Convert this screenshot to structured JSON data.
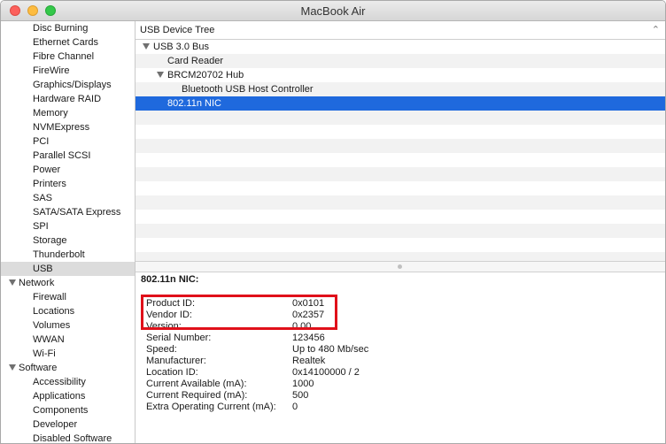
{
  "window": {
    "title": "MacBook Air"
  },
  "sidebar": {
    "items": [
      {
        "label": "Disc Burning",
        "level": 2
      },
      {
        "label": "Ethernet Cards",
        "level": 2
      },
      {
        "label": "Fibre Channel",
        "level": 2
      },
      {
        "label": "FireWire",
        "level": 2
      },
      {
        "label": "Graphics/Displays",
        "level": 2
      },
      {
        "label": "Hardware RAID",
        "level": 2
      },
      {
        "label": "Memory",
        "level": 2
      },
      {
        "label": "NVMExpress",
        "level": 2
      },
      {
        "label": "PCI",
        "level": 2
      },
      {
        "label": "Parallel SCSI",
        "level": 2
      },
      {
        "label": "Power",
        "level": 2
      },
      {
        "label": "Printers",
        "level": 2
      },
      {
        "label": "SAS",
        "level": 2
      },
      {
        "label": "SATA/SATA Express",
        "level": 2
      },
      {
        "label": "SPI",
        "level": 2
      },
      {
        "label": "Storage",
        "level": 2
      },
      {
        "label": "Thunderbolt",
        "level": 2
      },
      {
        "label": "USB",
        "level": 2,
        "selected": true
      },
      {
        "label": "Network",
        "level": 1
      },
      {
        "label": "Firewall",
        "level": 2
      },
      {
        "label": "Locations",
        "level": 2
      },
      {
        "label": "Volumes",
        "level": 2
      },
      {
        "label": "WWAN",
        "level": 2
      },
      {
        "label": "Wi-Fi",
        "level": 2
      },
      {
        "label": "Software",
        "level": 1
      },
      {
        "label": "Accessibility",
        "level": 2
      },
      {
        "label": "Applications",
        "level": 2
      },
      {
        "label": "Components",
        "level": 2
      },
      {
        "label": "Developer",
        "level": 2
      },
      {
        "label": "Disabled Software",
        "level": 2
      }
    ]
  },
  "tree": {
    "header": "USB Device Tree",
    "rows": [
      {
        "label": "USB 3.0 Bus",
        "depth": 0,
        "expanded": true
      },
      {
        "label": "Card Reader",
        "depth": 1
      },
      {
        "label": "BRCM20702 Hub",
        "depth": 1,
        "expanded": true
      },
      {
        "label": "Bluetooth USB Host Controller",
        "depth": 2
      },
      {
        "label": "802.11n NIC",
        "depth": 1,
        "selected": true
      }
    ],
    "empty_rows": 11
  },
  "detail": {
    "title": "802.11n NIC:",
    "properties": [
      {
        "key": "Product ID:",
        "value": "0x0101"
      },
      {
        "key": "Vendor ID:",
        "value": "0x2357"
      },
      {
        "key": "Version:",
        "value": "0.00"
      },
      {
        "key": "Serial Number:",
        "value": "123456"
      },
      {
        "key": "Speed:",
        "value": "Up to 480 Mb/sec"
      },
      {
        "key": "Manufacturer:",
        "value": "Realtek"
      },
      {
        "key": "Location ID:",
        "value": "0x14100000 / 2"
      },
      {
        "key": "Current Available (mA):",
        "value": "1000"
      },
      {
        "key": "Current Required (mA):",
        "value": "500"
      },
      {
        "key": "Extra Operating Current (mA):",
        "value": "0"
      }
    ]
  },
  "colors": {
    "selection": "#1f69dd",
    "highlight_box": "#e0101a"
  }
}
